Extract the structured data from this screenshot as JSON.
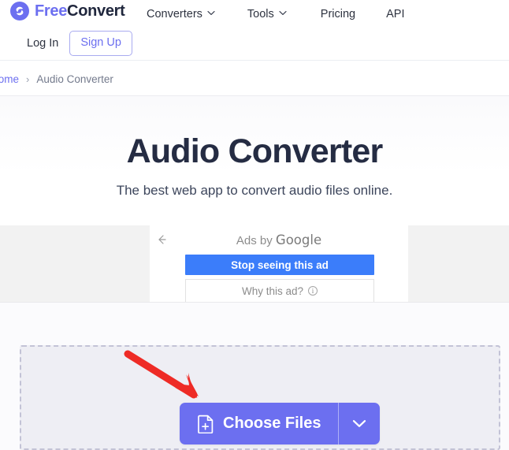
{
  "header": {
    "logo": {
      "icon": "freeconvert-circle-icon",
      "text_primary": "Free",
      "text_secondary": "Convert"
    },
    "nav": [
      {
        "label": "Converters",
        "has_dropdown": true,
        "icon": "chevron-down-icon"
      },
      {
        "label": "Tools",
        "has_dropdown": true,
        "icon": "chevron-down-icon"
      },
      {
        "label": "Pricing",
        "has_dropdown": false
      },
      {
        "label": "API",
        "has_dropdown": false
      }
    ],
    "auth": {
      "login_label": "Log In",
      "signup_label": "Sign Up"
    }
  },
  "breadcrumb": {
    "home_label": "Home",
    "separator": "›",
    "current_label": "Audio Converter"
  },
  "hero": {
    "title": "Audio Converter",
    "subtitle": "The best web app to convert audio files online."
  },
  "ad": {
    "back_icon": "back-arrow-icon",
    "attribution_prefix": "Ads by ",
    "attribution_brand": "Google",
    "stop_label": "Stop seeing this ad",
    "why_label": "Why this ad?",
    "why_icon": "info-icon"
  },
  "dropzone": {
    "choose_files_label": "Choose Files",
    "file_icon": "file-add-icon",
    "dropdown_icon": "chevron-down-icon"
  },
  "annotation": {
    "arrow_icon": "red-pointer-arrow",
    "arrow_color": "#ee2b26"
  },
  "colors": {
    "brand_purple": "#6c6ff0",
    "title_navy": "#252c43",
    "ad_blue": "#3b7dfa",
    "dropzone_fill": "#eeeef4",
    "dropzone_border": "#c3c3d6",
    "annotation_red": "#ee2b26"
  }
}
